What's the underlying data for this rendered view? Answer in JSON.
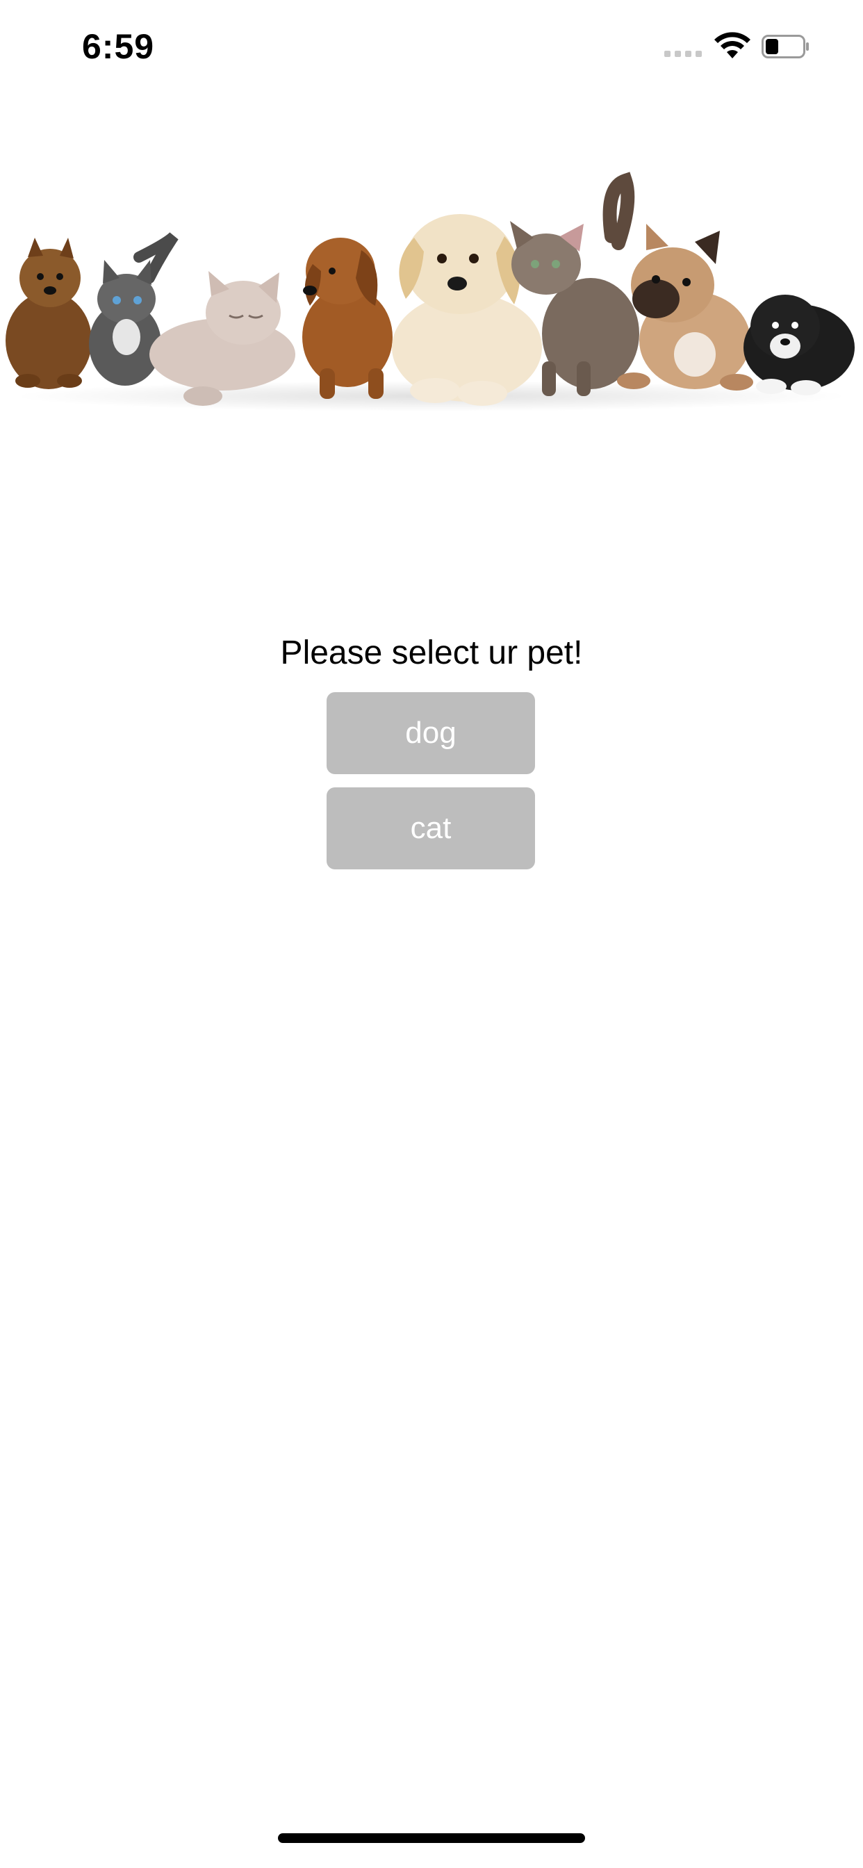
{
  "status_bar": {
    "time": "6:59",
    "icons": [
      "cellular-signal-icon",
      "wifi-icon",
      "battery-icon"
    ],
    "battery_level": 0.3
  },
  "hero": {
    "image": "pets-banner-image",
    "subjects": [
      "puppy",
      "kitten",
      "kitten",
      "puppy",
      "puppy",
      "kitten",
      "puppy",
      "puppy"
    ]
  },
  "main": {
    "prompt": "Please select ur pet!",
    "buttons": [
      {
        "label": "dog"
      },
      {
        "label": "cat"
      }
    ]
  },
  "colors": {
    "button_bg": "#bdbdbd",
    "button_text": "#ffffff",
    "background": "#ffffff"
  }
}
